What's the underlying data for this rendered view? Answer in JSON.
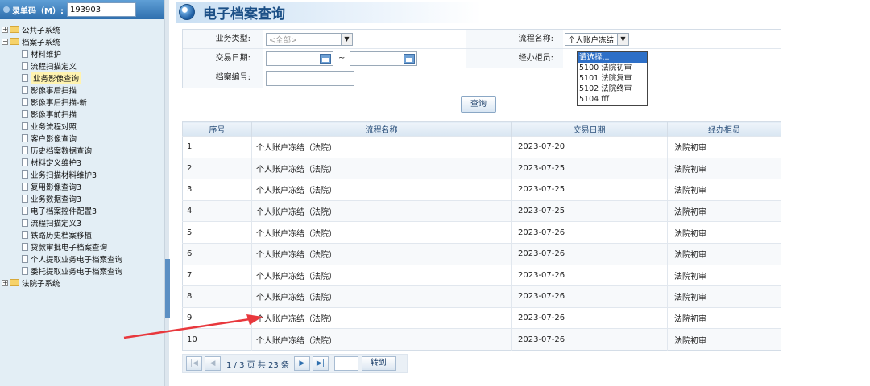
{
  "sidebar": {
    "entry_label": "录单码（M）:",
    "entry_value": "193903",
    "tree": [
      {
        "label": "公共子系统",
        "level": 1,
        "expanded": false,
        "type": "folder"
      },
      {
        "label": "档案子系统",
        "level": 1,
        "expanded": true,
        "type": "folder"
      },
      {
        "label": "材料维护",
        "level": 2,
        "type": "doc"
      },
      {
        "label": "流程扫描定义",
        "level": 2,
        "type": "doc"
      },
      {
        "label": "业务影像查询",
        "level": 2,
        "type": "doc",
        "active": true
      },
      {
        "label": "影像事后扫描",
        "level": 2,
        "type": "doc"
      },
      {
        "label": "影像事后扫描-新",
        "level": 2,
        "type": "doc"
      },
      {
        "label": "影像事前扫描",
        "level": 2,
        "type": "doc"
      },
      {
        "label": "业务流程对照",
        "level": 2,
        "type": "doc"
      },
      {
        "label": "客户影像查询",
        "level": 2,
        "type": "doc"
      },
      {
        "label": "历史档案数据查询",
        "level": 2,
        "type": "doc"
      },
      {
        "label": "材料定义维护3",
        "level": 2,
        "type": "doc"
      },
      {
        "label": "业务扫描材料维护3",
        "level": 2,
        "type": "doc"
      },
      {
        "label": "复用影像查询3",
        "level": 2,
        "type": "doc"
      },
      {
        "label": "业务数据查询3",
        "level": 2,
        "type": "doc"
      },
      {
        "label": "电子档案控件配置3",
        "level": 2,
        "type": "doc"
      },
      {
        "label": "流程扫描定义3",
        "level": 2,
        "type": "doc"
      },
      {
        "label": "铁路历史档案移植",
        "level": 2,
        "type": "doc"
      },
      {
        "label": "贷款审批电子档案查询",
        "level": 2,
        "type": "doc"
      },
      {
        "label": "个人提取业务电子档案查询",
        "level": 2,
        "type": "doc"
      },
      {
        "label": "委托提取业务电子档案查询",
        "level": 2,
        "type": "doc"
      },
      {
        "label": "法院子系统",
        "level": 1,
        "expanded": false,
        "type": "folder"
      }
    ]
  },
  "page": {
    "title": "电子档案查询"
  },
  "form": {
    "biz_type_label": "业务类型:",
    "biz_type_value": "<全部>",
    "flow_name_label": "流程名称:",
    "flow_name_value": "个人账户冻结",
    "date_label": "交易日期:",
    "date_sep": "~",
    "counter_label": "经办柜员:",
    "archive_no_label": "档案编号:",
    "counter_options": [
      "请选择...",
      "5100 法院初审",
      "5101 法院复审",
      "5102 法院终审",
      "5104 fff"
    ],
    "query_button": "查询"
  },
  "table": {
    "headers": [
      "序号",
      "流程名称",
      "交易日期",
      "经办柜员"
    ],
    "rows": [
      [
        "1",
        "个人账户冻结（法院）",
        "2023-07-20",
        "法院初审"
      ],
      [
        "2",
        "个人账户冻结（法院）",
        "2023-07-25",
        "法院初审"
      ],
      [
        "3",
        "个人账户冻结（法院）",
        "2023-07-25",
        "法院初审"
      ],
      [
        "4",
        "个人账户冻结（法院）",
        "2023-07-25",
        "法院初审"
      ],
      [
        "5",
        "个人账户冻结（法院）",
        "2023-07-26",
        "法院初审"
      ],
      [
        "6",
        "个人账户冻结（法院）",
        "2023-07-26",
        "法院初审"
      ],
      [
        "7",
        "个人账户冻结（法院）",
        "2023-07-26",
        "法院初审"
      ],
      [
        "8",
        "个人账户冻结（法院）",
        "2023-07-26",
        "法院初审"
      ],
      [
        "9",
        "个人账户冻结（法院）",
        "2023-07-26",
        "法院初审"
      ],
      [
        "10",
        "个人账户冻结（法院）",
        "2023-07-26",
        "法院初审"
      ]
    ]
  },
  "pager": {
    "info": "1 / 3 页 共 23 条",
    "go_button": "转到"
  },
  "colors": {
    "accent": "#1b4f86",
    "annotation_arrow": "#e8383d"
  }
}
